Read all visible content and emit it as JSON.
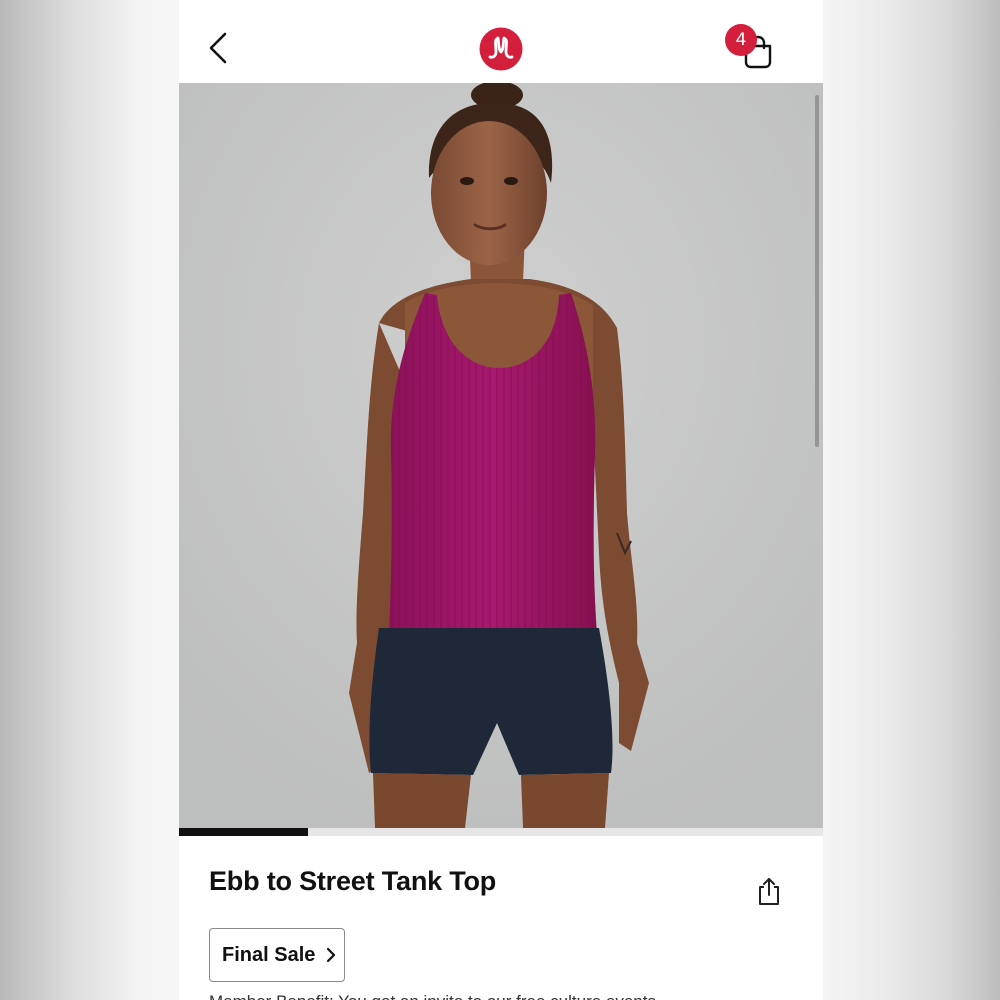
{
  "header": {
    "back_icon": "chevron-left-icon",
    "logo_icon": "lululemon-logo",
    "bag_icon": "shopping-bag-icon",
    "bag_count": "4",
    "brand_color": "#d31f3c"
  },
  "product": {
    "title": "Ebb to Street Tank Top",
    "final_sale_label": "Final Sale",
    "member_text": "Member Benefit: You get an invite to our free culture events",
    "image_position": 1,
    "image_count": 5,
    "share_icon": "share-icon",
    "tank_color": "#a3176b"
  }
}
